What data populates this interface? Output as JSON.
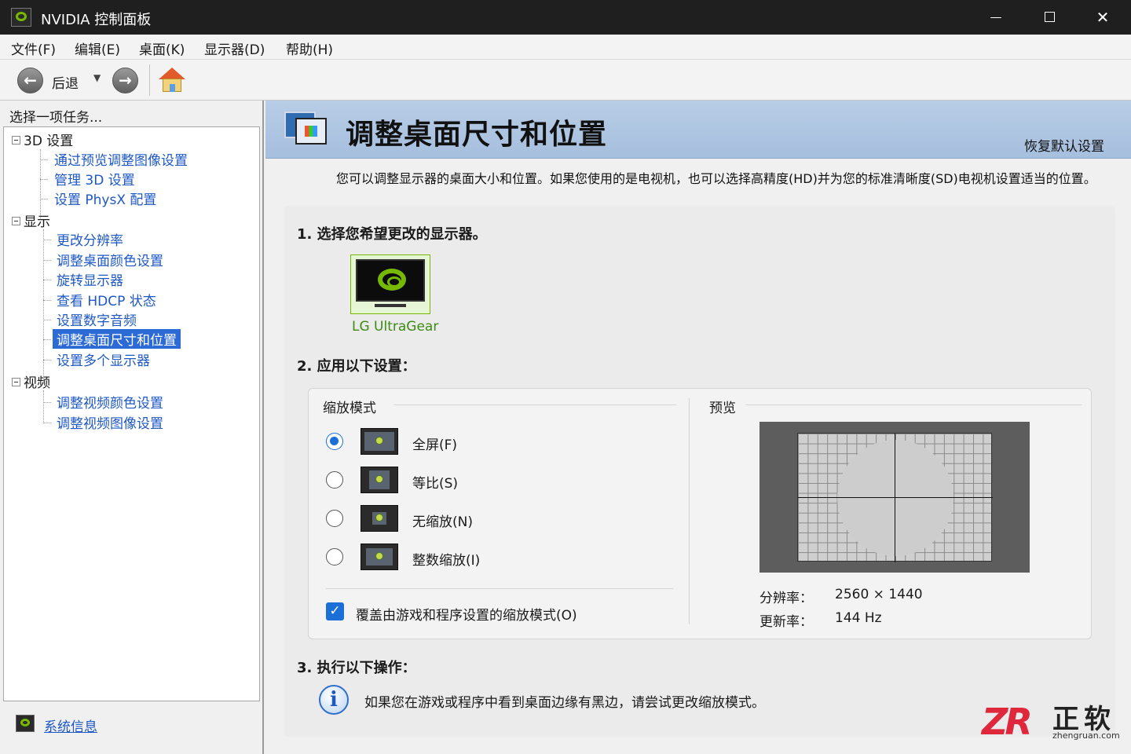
{
  "window": {
    "title": "NVIDIA 控制面板",
    "controls": {
      "minimize_icon": "minimize-icon",
      "maximize_icon": "maximize-icon",
      "close_icon": "close-icon",
      "close_glyph": "✕"
    }
  },
  "menubar": {
    "items": [
      {
        "label": "文件(F)"
      },
      {
        "label": "编辑(E)"
      },
      {
        "label": "桌面(K)"
      },
      {
        "label": "显示器(D)"
      },
      {
        "label": "帮助(H)"
      }
    ]
  },
  "toolbar": {
    "back_glyph": "←",
    "back_label": "后退",
    "dropdown_glyph": "▼",
    "forward_glyph": "→"
  },
  "sidebar": {
    "header": "选择一项任务...",
    "tree": [
      {
        "label": "3D 设置",
        "children": [
          "通过预览调整图像设置",
          "管理 3D 设置",
          "设置 PhysX 配置"
        ]
      },
      {
        "label": "显示",
        "children": [
          "更改分辨率",
          "调整桌面颜色设置",
          "旋转显示器",
          "查看 HDCP 状态",
          "设置数字音频",
          "调整桌面尺寸和位置",
          "设置多个显示器"
        ]
      },
      {
        "label": "视频",
        "children": [
          "调整视频颜色设置",
          "调整视频图像设置"
        ]
      }
    ],
    "selected": "调整桌面尺寸和位置",
    "system_info_link": "系统信息"
  },
  "main": {
    "title": "调整桌面尺寸和位置",
    "restore_defaults": "恢复默认设置",
    "description": "您可以调整显示器的桌面大小和位置。如果您使用的是电视机，也可以选择高精度(HD)并为您的标准清晰度(SD)电视机设置适当的位置。",
    "step1": "1. 选择您希望更改的显示器。",
    "monitor_name": "LG UltraGear",
    "step2": "2. 应用以下设置：",
    "scaling": {
      "group_title": "缩放模式",
      "modes": [
        {
          "label": "全屏(F)",
          "checked": true
        },
        {
          "label": "等比(S)",
          "checked": false
        },
        {
          "label": "无缩放(N)",
          "checked": false
        },
        {
          "label": "整数缩放(I)",
          "checked": false
        }
      ],
      "override_checked": true,
      "override_glyph": "✓",
      "override_label": "覆盖由游戏和程序设置的缩放模式(O)"
    },
    "preview": {
      "title": "预览",
      "resolution_label": "分辨率：",
      "resolution_value": "2560 × 1440",
      "refresh_label": "更新率：",
      "refresh_value": "144 Hz"
    },
    "step3": "3. 执行以下操作：",
    "info_glyph": "i",
    "action_text": "如果您在游戏或程序中看到桌面边缘有黑边，请尝试更改缩放模式。"
  },
  "watermark": {
    "mark": "ZR",
    "name": "正软",
    "domain": "zhengruan.com"
  },
  "colors": {
    "nvidia_green": "#76b900",
    "link_blue": "#1e58c4",
    "selection_blue": "#2c6bd6",
    "banner_blue": "#a6bfde",
    "watermark_red": "#e0283c"
  }
}
